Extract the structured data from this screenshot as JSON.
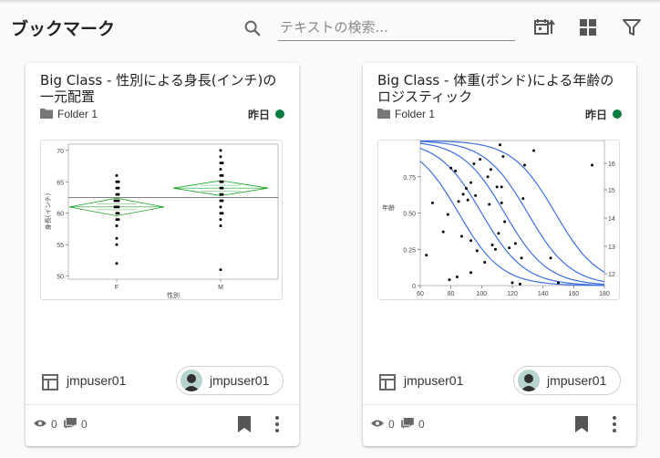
{
  "header": {
    "title": "ブックマーク",
    "search_placeholder": "テキストの検索..."
  },
  "cards": [
    {
      "title": "Big Class - 性別による身長(インチ)の一元配置",
      "folder": "Folder 1",
      "date": "昨日",
      "status_color": "#0a7d3e",
      "owner": "jmpuser01",
      "user": "jmpuser01",
      "views": "0",
      "comments": "0",
      "chart_data": {
        "type": "scatter",
        "xlabel": "性別",
        "ylabel": "身長(インチ)",
        "categories": [
          "F",
          "M"
        ],
        "ylim": [
          49.5,
          71
        ],
        "yticks": [
          "50",
          "55",
          "60",
          "65",
          "70"
        ],
        "grand_mean": 62.5,
        "groups": [
          {
            "name": "F",
            "mean": 61.0,
            "ci": [
              59.6,
              62.4
            ],
            "values": [
              66,
              65,
              65,
              64,
              64,
              63,
              63,
              62,
              62,
              62,
              61,
              61,
              61,
              60,
              60,
              59,
              59,
              58,
              56,
              55,
              52
            ]
          },
          {
            "name": "M",
            "mean": 64.0,
            "ci": [
              62.8,
              65.2
            ],
            "values": [
              70,
              69,
              68,
              68,
              67,
              66,
              66,
              65,
              65,
              64,
              64,
              63,
              63,
              62,
              62,
              61,
              60,
              60,
              59,
              58,
              51
            ]
          }
        ]
      }
    },
    {
      "title": "Big Class - 体重(ポンド)による年齢のロジスティック",
      "folder": "Folder 1",
      "date": "昨日",
      "status_color": "#0a7d3e",
      "owner": "jmpuser01",
      "user": "jmpuser01",
      "views": "0",
      "comments": "0",
      "chart_data": {
        "type": "scatter",
        "ylabel": "年齢",
        "xlim": [
          60,
          180
        ],
        "ylim": [
          0,
          1
        ],
        "xticks": [
          "60",
          "80",
          "100",
          "120",
          "140",
          "160",
          "180"
        ],
        "yticks": [
          "0",
          "0.25",
          "0.50",
          "0.75"
        ],
        "right_ticks": [
          "12",
          "13",
          "14",
          "15",
          "16"
        ],
        "curve_midpoints": [
          85,
          100,
          115,
          130,
          148
        ],
        "points": [
          [
            64,
            0.21
          ],
          [
            68,
            0.57
          ],
          [
            75,
            0.37
          ],
          [
            78,
            0.49
          ],
          [
            79,
            0.04
          ],
          [
            80,
            0.81
          ],
          [
            83,
            0.79
          ],
          [
            84,
            0.06
          ],
          [
            85,
            0.58
          ],
          [
            87,
            0.34
          ],
          [
            88,
            0.63
          ],
          [
            90,
            0.67
          ],
          [
            91,
            0.59
          ],
          [
            93,
            0.09
          ],
          [
            93,
            0.71
          ],
          [
            93,
            0.31
          ],
          [
            95,
            0.84
          ],
          [
            96,
            0.62
          ],
          [
            97,
            0.24
          ],
          [
            99,
            0.87
          ],
          [
            102,
            0.16
          ],
          [
            104,
            0.75
          ],
          [
            105,
            0.56
          ],
          [
            106,
            0.8
          ],
          [
            107,
            0.28
          ],
          [
            109,
            0.25
          ],
          [
            110,
            0.68
          ],
          [
            111,
            0.36
          ],
          [
            112,
            0.97
          ],
          [
            113,
            0.57
          ],
          [
            113,
            0.68
          ],
          [
            114,
            0.89
          ],
          [
            115,
            0.44
          ],
          [
            118,
            0.26
          ],
          [
            120,
            0.02
          ],
          [
            122,
            0.29
          ],
          [
            125,
            0.01
          ],
          [
            126,
            0.19
          ],
          [
            127,
            0.6
          ],
          [
            128,
            0.83
          ],
          [
            134,
            0.93
          ],
          [
            145,
            0.19
          ],
          [
            150,
            0.02
          ],
          [
            172,
            0.83
          ]
        ]
      }
    }
  ]
}
